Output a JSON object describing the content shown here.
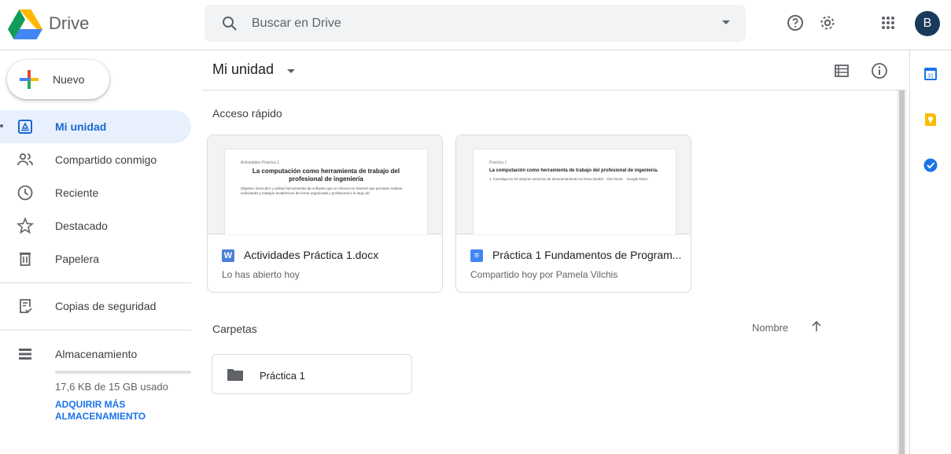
{
  "header": {
    "brand": "Drive",
    "search_placeholder": "Buscar en Drive",
    "avatar_initial": "B"
  },
  "sidebar": {
    "new_label": "Nuevo",
    "items": [
      {
        "label": "Mi unidad",
        "icon": "my-drive-icon",
        "active": true
      },
      {
        "label": "Compartido conmigo",
        "icon": "shared-icon",
        "active": false
      },
      {
        "label": "Reciente",
        "icon": "clock-icon",
        "active": false
      },
      {
        "label": "Destacado",
        "icon": "star-icon",
        "active": false
      },
      {
        "label": "Papelera",
        "icon": "trash-icon",
        "active": false
      },
      {
        "label": "Copias de seguridad",
        "icon": "backup-icon",
        "active": false
      },
      {
        "label": "Almacenamiento",
        "icon": "storage-icon",
        "active": false
      }
    ],
    "storage_used_text": "17,6 KB de 15 GB usado",
    "storage_fraction": 0.0,
    "buy_storage_label": "ADQUIRIR MÁS ALMACENAMIENTO"
  },
  "main": {
    "title": "Mi unidad",
    "quick_access_label": "Acceso rápido",
    "quick_access": [
      {
        "name": "Actividades Práctica 1.docx",
        "subtitle": "Lo has abierto hoy",
        "type_icon": "word-icon",
        "type_letter": "W",
        "type_color": "#4a7fd8",
        "preview_small": "Actividades Práctica 1",
        "preview_heading": "La computación como herramienta de trabajo del profesional de ingeniería",
        "preview_body": "Objetivo: Descubrir y utilizar herramientas de software que se ofrecen en Internet que permitan realizar actividades y trabajos académicos de forma organizada y profesional a lo largo de"
      },
      {
        "name": "Práctica 1 Fundamentos de Program...",
        "subtitle": "Compartido hoy por Pamela Vilchis",
        "type_icon": "docs-icon",
        "type_letter": "≡",
        "type_color": "#4285f4",
        "preview_small": "Práctica 1",
        "preview_heading": "La computación como herramienta de trabajo del profesional de ingeniería.",
        "preview_body": "1. Investiga los 10 mejores servicios de almacenamiento en línea (Nube) · One Drive: · Google Drive:"
      }
    ],
    "folders_label": "Carpetas",
    "sort_label": "Nombre",
    "folders": [
      {
        "name": "Práctica 1"
      }
    ]
  },
  "colors": {
    "accent": "#1a73e8",
    "active_bg": "#e8f0fe",
    "search_bg": "#f1f3f4"
  }
}
